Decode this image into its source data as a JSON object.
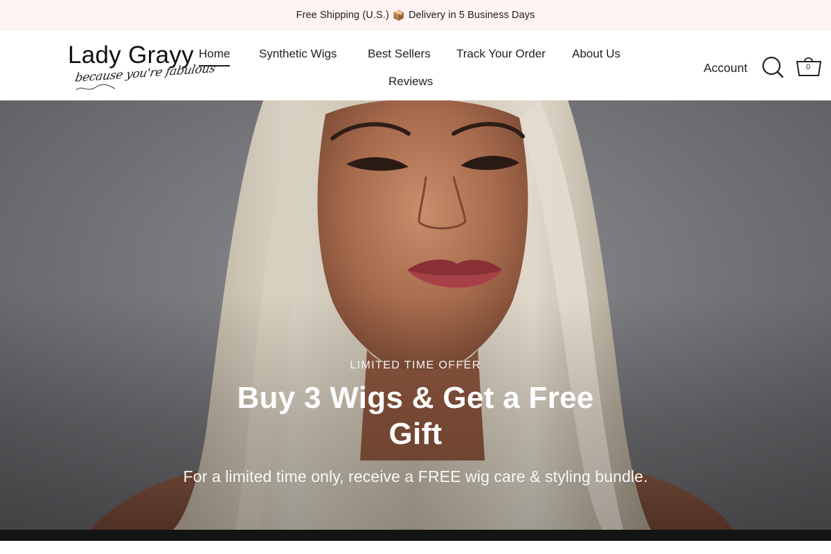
{
  "announcement": {
    "text_before": "Free Shipping (U.S.)",
    "emoji": "📦",
    "text_after": "Delivery in 5 Business Days"
  },
  "logo": {
    "wordmark": "Lady Grayy",
    "tagline": "because you're fabulous"
  },
  "nav": {
    "items": [
      {
        "label": "Home",
        "active": true
      },
      {
        "label": "Synthetic Wigs"
      },
      {
        "label": "Best Sellers"
      },
      {
        "label": "Track Your Order"
      },
      {
        "label": "About Us"
      },
      {
        "label": "Reviews"
      }
    ]
  },
  "header_actions": {
    "account_label": "Account",
    "search_icon": "search-icon",
    "cart_icon": "cart-icon",
    "cart_count": "0"
  },
  "hero": {
    "eyebrow": "LIMITED TIME OFFER",
    "title": "Buy 3 Wigs & Get a Free Gift",
    "subtitle": "For a limited time only, receive a FREE wig care & styling bundle.",
    "image": "model-with-platinum-blonde-wig-photo"
  },
  "colors": {
    "announcement_bg": "#fff4f2",
    "hero_text": "#ffffff",
    "text_dark": "#1c1c1c"
  }
}
